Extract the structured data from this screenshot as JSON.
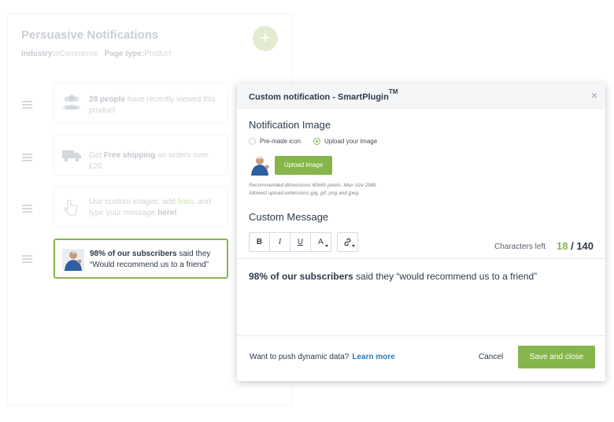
{
  "background": {
    "title": "Persuasive Notifications",
    "industry_label": "Industry:",
    "industry_value": "eCommerce",
    "page_type_label": "Page type:",
    "page_type_value": "Product",
    "add_button_label": "+",
    "notifications": [
      {
        "icon": "people-icon",
        "bold": "28 people",
        "text": " have recently viewed this product"
      },
      {
        "icon": "truck-icon",
        "pre": "Get ",
        "bold": "Free shipping",
        "text": " on orders over £20"
      },
      {
        "icon": "pointer-icon",
        "pre": "Use custom images, add ",
        "highlight": "links",
        "mid": ", and type your message ",
        "bold": "here!"
      },
      {
        "icon": "avatar-image",
        "bold": "98% of our subscribers",
        "text": " said they “Would recommend us to a friend”"
      }
    ]
  },
  "modal": {
    "title": "Custom notification - SmartPlugin",
    "title_sup": "TM",
    "close_label": "×",
    "image_section_title": "Notification Image",
    "radio_premade": "Pre-made icon",
    "radio_upload": "Upload your image",
    "upload_button": "Upload image",
    "help_line1": "Recommended dimensions 60x60 pixels. Max size 2MB.",
    "help_line2": "Allowed upload extensions jpg, gif, png and jpeg.",
    "message_section_title": "Custom Message",
    "toolbar": {
      "bold": "B",
      "italic": "I",
      "underline": "U",
      "color": "A",
      "link": "🔗"
    },
    "chars_left_label": "Characters left",
    "chars_used": "18",
    "chars_sep": " / ",
    "chars_max": "140",
    "message_bold": "98% of our subscribers",
    "message_rest": " said they “would recommend us to a friend”",
    "push_text": "Want to push dynamic data?",
    "learn_more": "Learn more",
    "cancel": "Cancel",
    "save": "Save and close"
  },
  "colors": {
    "accent": "#86b64b",
    "link": "#2c7bbf",
    "text": "#2d3a4a"
  }
}
